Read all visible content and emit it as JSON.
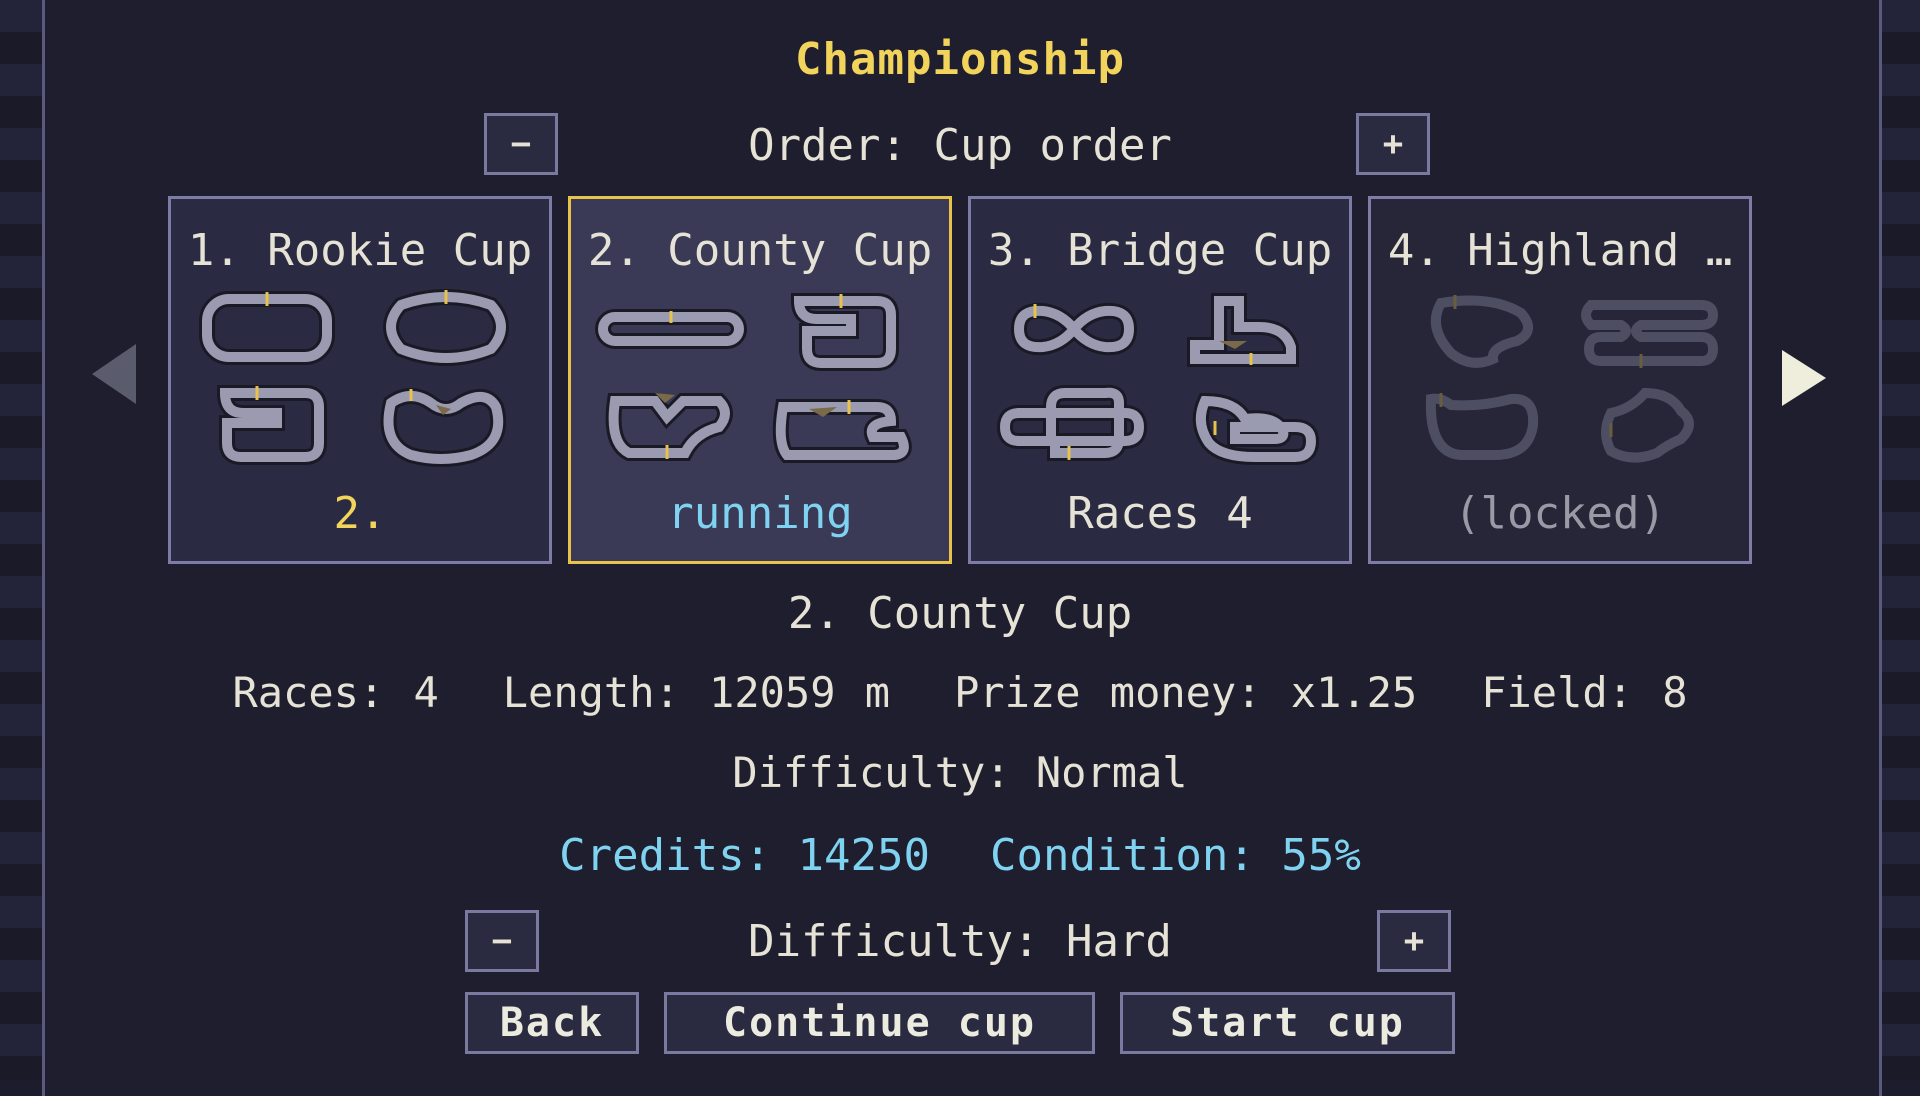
{
  "title": "Championship",
  "order": {
    "minus_label": "−",
    "text": "Order: Cup order",
    "plus_label": "+"
  },
  "cups": [
    {
      "title": "1. Rookie Cup",
      "status": "2.",
      "status_color": "#f2d45c"
    },
    {
      "title": "2. County Cup",
      "status": "running",
      "status_color": "#7fd3f0"
    },
    {
      "title": "3. Bridge Cup",
      "status": "Races 4",
      "status_color": "#e6e3d6"
    },
    {
      "title": "4. Highland …",
      "status": "(locked)",
      "status_color": "#9a9aa6"
    }
  ],
  "selected": {
    "name": "2. County Cup",
    "races": "Races: 4",
    "length": "Length: 12059 m",
    "prize": "Prize money: x1.25",
    "field": "Field: 8",
    "difficulty": "Difficulty: Normal"
  },
  "credits": "Credits: 14250",
  "condition": "Condition: 55%",
  "difficulty_select": {
    "minus_label": "−",
    "text": "Difficulty: Hard",
    "plus_label": "+"
  },
  "buttons": {
    "back": "Back",
    "continue": "Continue cup",
    "start": "Start cup"
  },
  "colors": {
    "accent_yellow": "#f2d45c",
    "accent_cyan": "#7fd3f0",
    "border": "#7c7ca6",
    "selected_border": "#e8c24a"
  }
}
